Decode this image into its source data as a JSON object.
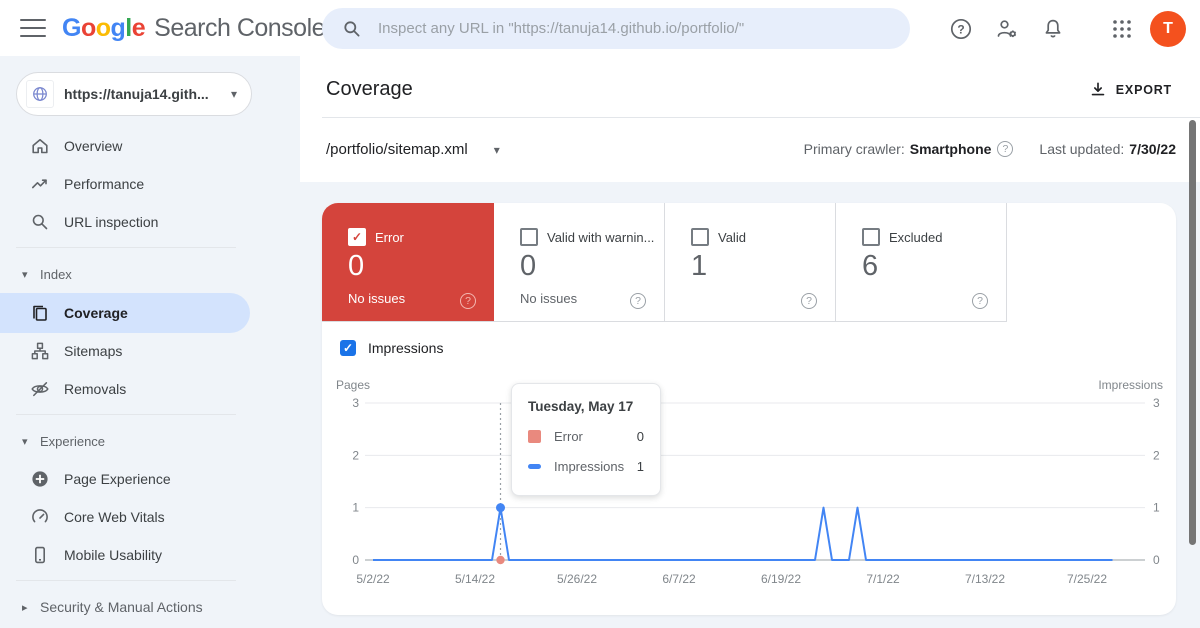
{
  "colors": {
    "accent_blue": "#1a73e8",
    "chart_line_blue": "#4285f4",
    "error_red": "#d4443c",
    "error_salmon": "#e9897e",
    "selected_pill_blue": "#d3e3fd",
    "avatar_orange": "#f4511e"
  },
  "icons": {
    "caret_down": "▾",
    "caret_right": "▸",
    "check": "✓",
    "question": "?"
  },
  "header": {
    "logo": {
      "letters": [
        "G",
        "o",
        "o",
        "g",
        "l",
        "e"
      ],
      "suffix": "Search Console"
    },
    "search_placeholder": "Inspect any URL in \"https://tanuja14.github.io/portfolio/\"",
    "avatar_letter": "T"
  },
  "sidebar": {
    "property_label": "https://tanuja14.gith...",
    "primary_items": [
      {
        "label": "Overview"
      },
      {
        "label": "Performance"
      },
      {
        "label": "URL inspection"
      }
    ],
    "index_section": {
      "label": "Index",
      "items": [
        {
          "label": "Coverage",
          "selected": true
        },
        {
          "label": "Sitemaps",
          "selected": false
        },
        {
          "label": "Removals",
          "selected": false
        }
      ]
    },
    "experience_section": {
      "label": "Experience",
      "items": [
        {
          "label": "Page Experience"
        },
        {
          "label": "Core Web Vitals"
        },
        {
          "label": "Mobile Usability"
        }
      ]
    },
    "security_section": {
      "label": "Security & Manual Actions"
    }
  },
  "main": {
    "title": "Coverage",
    "export_label": "EXPORT",
    "sitemap_selector": "/portfolio/sitemap.xml",
    "primary_crawler_label": "Primary crawler:",
    "primary_crawler_value": "Smartphone",
    "last_updated_label": "Last updated:",
    "last_updated_value": "7/30/22",
    "impressions_toggle_label": "Impressions"
  },
  "cards": [
    {
      "label": "Error",
      "value": "0",
      "sub": "No issues",
      "checked": true
    },
    {
      "label": "Valid with warnin...",
      "value": "0",
      "sub": "No issues",
      "checked": false
    },
    {
      "label": "Valid",
      "value": "1",
      "sub": "",
      "checked": false
    },
    {
      "label": "Excluded",
      "value": "6",
      "sub": "",
      "checked": false
    }
  ],
  "chart_data": {
    "type": "line",
    "left_axis_label": "Pages",
    "right_axis_label": "Impressions",
    "ylim": [
      0,
      3
    ],
    "y_ticks": [
      0,
      1,
      2,
      3
    ],
    "x_ticks": [
      {
        "day": 0,
        "label": "5/2/22"
      },
      {
        "day": 12,
        "label": "5/14/22"
      },
      {
        "day": 24,
        "label": "5/26/22"
      },
      {
        "day": 36,
        "label": "6/7/22"
      },
      {
        "day": 48,
        "label": "6/19/22"
      },
      {
        "day": 60,
        "label": "7/1/22"
      },
      {
        "day": 72,
        "label": "7/13/22"
      },
      {
        "day": 84,
        "label": "7/25/22"
      }
    ],
    "series": [
      {
        "name": "Impressions",
        "color": "#4285f4",
        "points": [
          [
            0,
            0
          ],
          [
            14,
            0
          ],
          [
            15,
            1
          ],
          [
            16,
            0
          ],
          [
            52,
            0
          ],
          [
            53,
            1
          ],
          [
            54,
            0
          ],
          [
            56,
            0
          ],
          [
            57,
            1
          ],
          [
            58,
            0
          ],
          [
            87,
            0
          ]
        ]
      },
      {
        "name": "Error",
        "color": "#e9897e",
        "points": [
          [
            0,
            0
          ],
          [
            87,
            0
          ]
        ]
      }
    ],
    "highlight": {
      "day": 15,
      "error_value": 0,
      "impressions_value": 1
    },
    "tooltip": {
      "title": "Tuesday, May 17",
      "rows": [
        {
          "label": "Error",
          "value": "0"
        },
        {
          "label": "Impressions",
          "value": "1"
        }
      ]
    }
  }
}
